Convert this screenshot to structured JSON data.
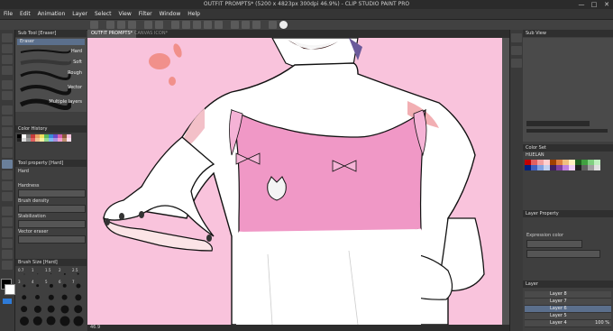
{
  "window": {
    "title": "OUTFIT PROMPTS* (5200 x 4823px 300dpi 46.9%) - CLIP STUDIO PAINT PRO",
    "min": "—",
    "max": "□",
    "close": "✕"
  },
  "menu": [
    "File",
    "Edit",
    "Animation",
    "Layer",
    "Select",
    "View",
    "Filter",
    "Window",
    "Help"
  ],
  "sub_tool": {
    "title": "Sub Tool [Eraser]",
    "items": [
      "Eraser",
      "Hard",
      "Soft",
      "Rough",
      "Vector",
      "Multiple layers"
    ]
  },
  "color_history": {
    "title": "Color History"
  },
  "tool_property": {
    "title": "Tool property [Hard]",
    "tool_name": "Hard",
    "labels": [
      "Hardness",
      "Brush density",
      "Stabilization",
      "Vector eraser"
    ]
  },
  "brush_size": {
    "title": "Brush Size [Hard]",
    "sizes": [
      "0.7",
      "1",
      "1.5",
      "2",
      "2.5",
      "3",
      "4",
      "5",
      "6",
      "7",
      "8",
      "10",
      "12",
      "15",
      "17",
      "20",
      "25",
      "30",
      "40",
      "50",
      "60",
      "70",
      "80",
      "100",
      "120"
    ]
  },
  "doc_tabs": [
    {
      "label": "OUTFIT PROMPTS*",
      "active": true
    },
    {
      "label": "CANVAS ICON*",
      "active": false
    }
  ],
  "status": {
    "zoom": "46.9"
  },
  "right": {
    "sub_view": "Sub View",
    "color_set": "Color Set",
    "color_set_name": "HUELAN",
    "layer_property": "Layer Property",
    "expression_color": "Expression color",
    "layer_title": "Layer",
    "layers": [
      "Layer 8",
      "Layer 7",
      "Layer 6",
      "Layer 5",
      "Layer 4"
    ],
    "zoom_readout": "100 %"
  },
  "colors": {
    "canvas_bg": "#f9c3dc",
    "shirt_pink": "#f098c6",
    "skin_shadow": "#f3c0c8",
    "cheek_blush": "#e97a80",
    "accent_orange": "#f0877d",
    "accent_blue": "#2e7bd8"
  },
  "palette": [
    "#000000",
    "#ffffff",
    "#7a7a7a",
    "#c43c3c",
    "#e8a060",
    "#f0e060",
    "#5cb85c",
    "#3a8ad8",
    "#6a4cc8",
    "#d860b0",
    "#8a5a3a",
    "#f9c3dc",
    "#222222",
    "#dddddd",
    "#999999",
    "#e06060",
    "#f0c090",
    "#f8f0a0",
    "#90d890",
    "#80b8f0",
    "#a890e0",
    "#f0a0d0",
    "#c09070",
    "#ffe0ec"
  ],
  "swatches": [
    "#c00000",
    "#e06060",
    "#f0a0a0",
    "#ffd0d0",
    "#a04000",
    "#e08040",
    "#f0c080",
    "#fff0c0",
    "#206020",
    "#40a040",
    "#80d080",
    "#c0f0c0",
    "#002080",
    "#4060c0",
    "#80a0e0",
    "#c0d0f0",
    "#402060",
    "#8040a0",
    "#c080e0",
    "#f0d0f8",
    "#202020",
    "#606060",
    "#a0a0a0",
    "#e0e0e0"
  ]
}
